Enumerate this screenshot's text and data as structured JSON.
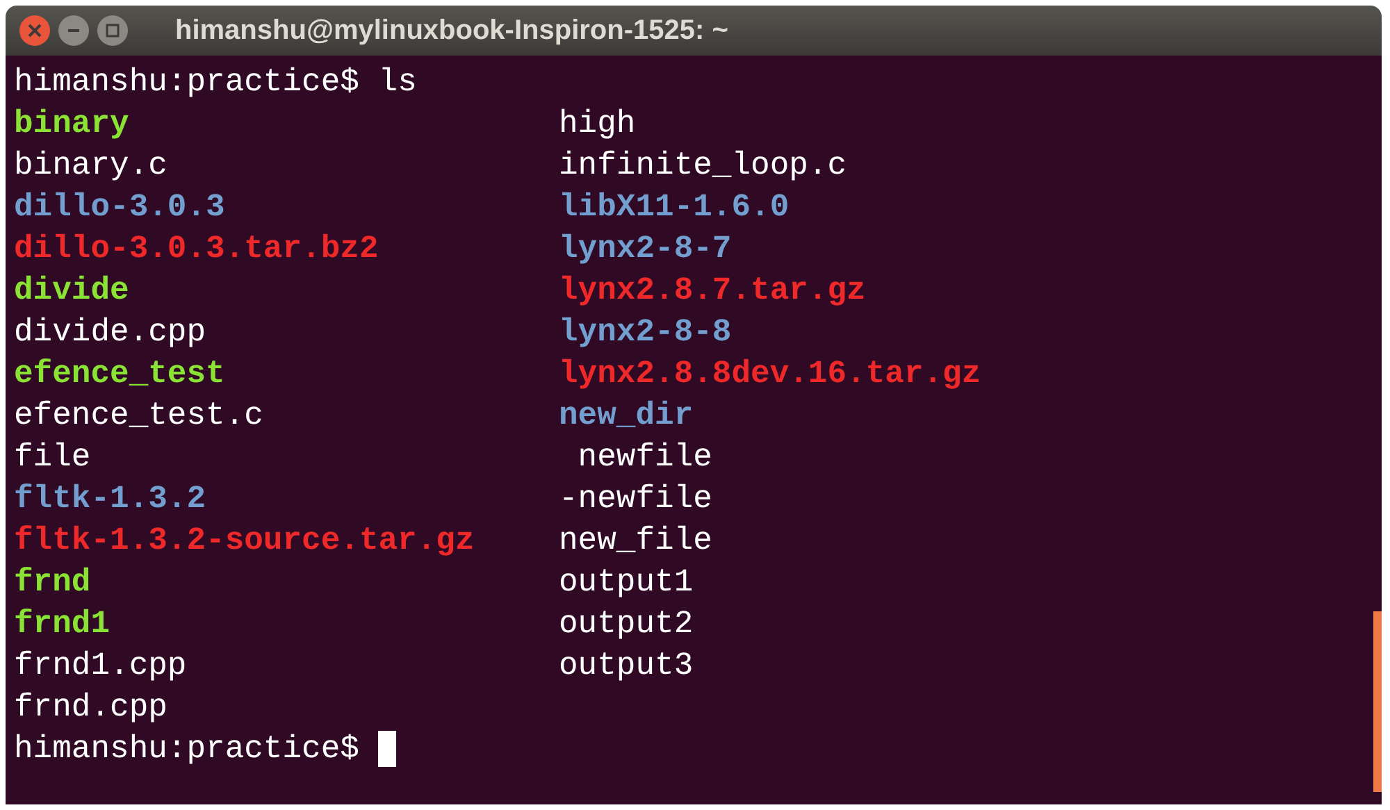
{
  "window": {
    "title": "himanshu@mylinuxbook-Inspiron-1525: ~"
  },
  "terminal": {
    "command_line": {
      "prompt": "himanshu:practice$",
      "command": "ls"
    },
    "columns": [
      [
        {
          "name": "binary",
          "kind": "exec"
        },
        {
          "name": "binary.c",
          "kind": "file"
        },
        {
          "name": "dillo-3.0.3",
          "kind": "dir"
        },
        {
          "name": "dillo-3.0.3.tar.bz2",
          "kind": "archive"
        },
        {
          "name": "divide",
          "kind": "exec"
        },
        {
          "name": "divide.cpp",
          "kind": "file"
        },
        {
          "name": "efence_test",
          "kind": "exec"
        },
        {
          "name": "efence_test.c",
          "kind": "file"
        },
        {
          "name": "file",
          "kind": "file"
        },
        {
          "name": "fltk-1.3.2",
          "kind": "dir"
        },
        {
          "name": "fltk-1.3.2-source.tar.gz",
          "kind": "archive"
        },
        {
          "name": "frnd",
          "kind": "exec"
        },
        {
          "name": "frnd1",
          "kind": "exec"
        },
        {
          "name": "frnd1.cpp",
          "kind": "file"
        },
        {
          "name": "frnd.cpp",
          "kind": "file"
        }
      ],
      [
        {
          "name": "high",
          "kind": "file"
        },
        {
          "name": "infinite_loop.c",
          "kind": "file"
        },
        {
          "name": "libX11-1.6.0",
          "kind": "dir"
        },
        {
          "name": "lynx2-8-7",
          "kind": "dir"
        },
        {
          "name": "lynx2.8.7.tar.gz",
          "kind": "archive"
        },
        {
          "name": "lynx2-8-8",
          "kind": "dir"
        },
        {
          "name": "lynx2.8.8dev.16.tar.gz",
          "kind": "archive"
        },
        {
          "name": "new_dir",
          "kind": "dir"
        },
        {
          "name": " newfile",
          "kind": "file"
        },
        {
          "name": "-newfile",
          "kind": "file"
        },
        {
          "name": "new_file",
          "kind": "file"
        },
        {
          "name": "output1",
          "kind": "file"
        },
        {
          "name": "output2",
          "kind": "file"
        },
        {
          "name": "output3",
          "kind": "file"
        }
      ]
    ],
    "prompt_line": {
      "prompt": "himanshu:practice$"
    }
  }
}
